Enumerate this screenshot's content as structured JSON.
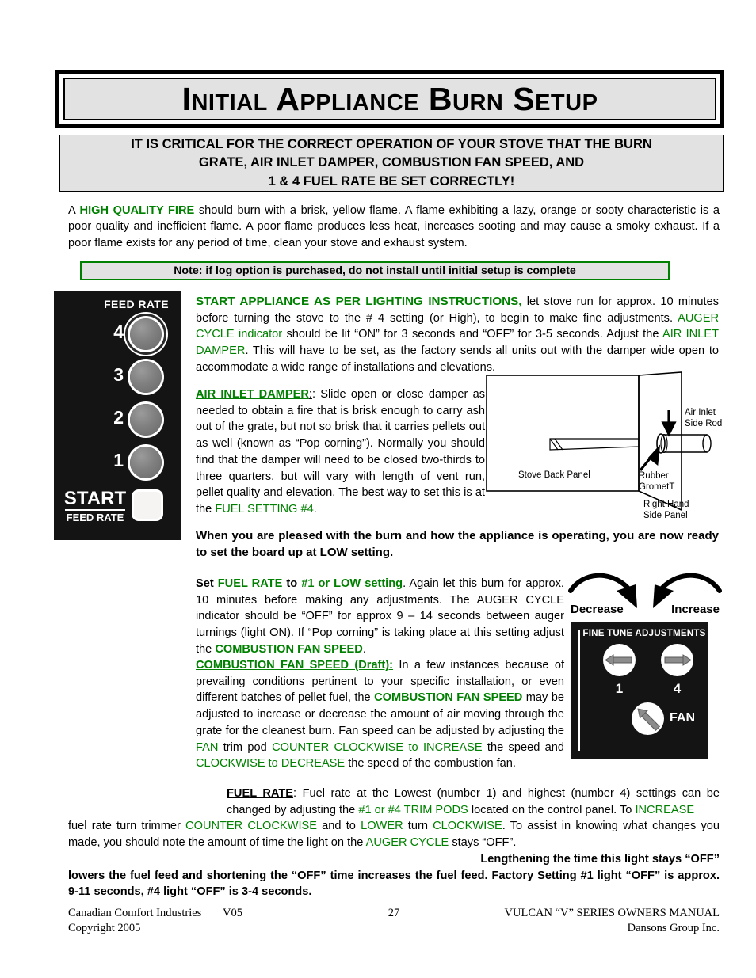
{
  "title": "Initial Appliance Burn Setup",
  "critical_notice": {
    "line1": "IT IS CRITICAL FOR THE CORRECT OPERATION OF YOUR STOVE THAT THE BURN",
    "line2": "GRATE, AIR INLET DAMPER, COMBUSTION FAN SPEED, AND",
    "line3": "1 & 4 FUEL RATE BE SET CORRECTLY!"
  },
  "intro": {
    "t1": "A ",
    "hl1": "HIGH QUALITY FIRE",
    "t2": " should burn with a brisk, yellow flame.  A flame exhibiting a lazy, orange or sooty characteristic is a poor quality and inefficient flame.  A poor flame produces less heat, increases sooting and may cause a smoky exhaust.  If a poor flame exists for any period of time, clean your stove and exhaust system."
  },
  "note_box": "Note: if log option is purchased, do not install until initial setup is complete",
  "control_panel": {
    "feed_rate_label": "FEED RATE",
    "leds": [
      "4",
      "3",
      "2",
      "1"
    ],
    "active_led": "4",
    "start_label": "START",
    "start_sub": "FEED RATE"
  },
  "p_start": {
    "heading": "START APPLIANCE AS PER LIGHTING INSTRUCTIONS",
    "t1": ",",
    "t2": " let stove run for approx. 10 minutes before turning the stove to the # 4 setting (or High), to begin to make fine adjustments.  ",
    "hl1": "AUGER CYCLE indicator",
    "t3": " should be lit “ON” for 3 seconds and  “OFF” for 3-5 seconds. Adjust the ",
    "hl2": "AIR INLET DAMPER",
    "t4": ". This will have to be set, as the factory sends all units out with the damper wide open to accommodate a wide range of installations and elevations."
  },
  "p_damper": {
    "heading": "AIR INLET DAMPER",
    "t1": ":   Slide open or close damper as needed to obtain a fire that is brisk enough to carry ash out of the grate, but not so brisk that it carries pellets out as well (known as “Pop corning”). Normally you should find that the damper will need to be closed two-thirds to three quarters, but will vary with length of vent run, pellet quality and elevation. The best way to set this is at the ",
    "hl1": "FUEL SETTING #4",
    "t2": "."
  },
  "diagram": {
    "label_air_inlet": "Air Inlet",
    "label_side_rod": "Side Rod",
    "label_rubber": "Rubber",
    "label_gromett": "GrometT",
    "label_stove_back": "Stove Back Panel",
    "label_right_hand": "Right Hand",
    "label_side_panel": "Side Panel"
  },
  "p_pleased": "When you are pleased with the burn and how the appliance is operating,   you are now ready to set the board up at LOW setting.",
  "p_setfuel": {
    "t1": "Set ",
    "hl1": "FUEL RATE",
    "t2": " to ",
    "hl2": "#1 or LOW setting",
    "t3": ".  Again let this burn for approx. 10 minutes before making any adjustments. The AUGER CYCLE indicator should be “OFF” for approx 9 – 14 seconds between auger turnings (light ON). If “Pop corning” is taking place at this setting adjust the ",
    "hl3": "COMBUSTION FAN SPEED",
    "t4": "."
  },
  "p_combustion": {
    "heading": "COMBUSTION FAN SPEED (Draft):",
    "t1": " In a few instances because of prevailing conditions pertinent to your specific installation, or even different batches of pellet fuel, the ",
    "hl1": "COMBUSTION FAN SPEED",
    "t2": " may be adjusted to increase or decrease the amount of air moving through the grate for the cleanest burn. Fan speed can be adjusted by adjusting the ",
    "hl2": "FAN",
    "t3": " trim pod ",
    "hl3": "COUNTER CLOCKWISE to INCREASE",
    "t4": " the speed and ",
    "hl4": "CLOCKWISE to DECREASE",
    "t5": " the speed of the combustion fan."
  },
  "p_fuelrate": {
    "heading": "FUEL RATE",
    "t1": ": Fuel rate at the Lowest (number 1) and highest (number 4) settings can be changed by adjusting the ",
    "hl1": "#1 or #4 TRIM PODS",
    "t2": " located on the control panel.  To ",
    "hl2": "INCREASE",
    "t3": " fuel rate turn trimmer ",
    "hl3": "COUNTER CLOCKWISE",
    "t4": " and to ",
    "hl4": "LOWER",
    "t5": " turn ",
    "hl5": "CLOCKWISE",
    "t6": ". To assist in knowing what changes you made, you should note the amount of time the light on the ",
    "hl6": "AUGER CYCLE",
    "t7": " stays “OFF”.",
    "b1": "Lengthening the time this light stays “OFF”",
    "t8": " lowers the fuel feed and shortening the “OFF” time increases the fuel feed",
    "b2": ". Factory Setting #1 light “OFF” is approx. 9-11 seconds, #4 light “OFF” is 3-4 seconds."
  },
  "adjust_arrows": {
    "decrease": "Decrease",
    "increase": "Increase"
  },
  "fine_tune": {
    "title": "FINE TUNE ADJUSTMENTS",
    "pod1": "1",
    "pod4": "4",
    "podfan": "FAN"
  },
  "footer": {
    "company": "Canadian Comfort Industries",
    "version": "V05",
    "page": "27",
    "manual": "VULCAN “V” SERIES OWNERS MANUAL",
    "copyright": "Copyright 2005",
    "group": "Dansons Group Inc."
  },
  "colors": {
    "accent_green": "#008000",
    "panel_black": "#141414",
    "box_gray": "#e2e2e2"
  }
}
